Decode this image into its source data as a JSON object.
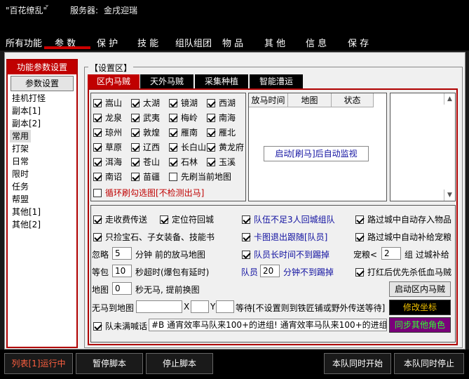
{
  "titlebar": {
    "app_name": "\"百花缭乱\"",
    "chevron": "ˇ",
    "server_label": "服务器:",
    "server_name": "金戌迎瑞"
  },
  "menu": [
    "所有功能",
    "参 数",
    "保 护",
    "技 能",
    "组队组团",
    "物 品",
    "其 他",
    "信 息",
    "保 存"
  ],
  "sidebar": {
    "title": "功能参数设置",
    "button": "参数设置",
    "items": [
      "挂机打怪",
      "副本[1]",
      "副本[2]",
      "常用",
      "打架",
      "日常",
      "限时",
      "任务",
      "帮盟",
      "其他[1]",
      "其他[2]"
    ]
  },
  "settings": {
    "group_label": "【设置区】",
    "tabs": [
      "区内马贼",
      "天外马贼",
      "采集种植",
      "智能漕运"
    ]
  },
  "regions": {
    "items": [
      "嵩山",
      "太湖",
      "镜湖",
      "西湖",
      "龙泉",
      "武夷",
      "梅岭",
      "南海",
      "琼州",
      "敦煌",
      "雁南",
      "雁北",
      "草原",
      "辽西",
      "长白山",
      "黄龙府",
      "洱海",
      "苍山",
      "石林",
      "玉溪",
      "南诏",
      "苗疆"
    ],
    "first_refresh": "先刷当前地图",
    "loop_refresh": "循环刷勾选图[不检测出马]"
  },
  "table": {
    "headers": [
      "放马时间",
      "地图",
      "状态"
    ],
    "monitor_button": "启动[刷马]后自动监视"
  },
  "options": {
    "row1": [
      "走收费传送",
      "定位符回城",
      "队伍不足3人回城组队",
      "路过城中自动存入物品"
    ],
    "row2": [
      "只捡宝石、子女装备、技能书",
      "卡图退出跟随[队员]",
      "路过城中自动补给宠粮"
    ],
    "ignore_pre": "忽略",
    "ignore_val": "5",
    "ignore_post": "分钟 前的放马地图",
    "member_long": "队员长时间不到踢掉",
    "pet_food_pre": "宠粮<",
    "pet_food_val": "2",
    "pet_food_post": "组 过城补给",
    "wait_pre": "等包",
    "wait_val": "10",
    "wait_post": "秒超时(爆包有延时)",
    "member_pre": "队员",
    "member_val": "20",
    "member_post": "分钟不到踢掉",
    "red_first": "打红后优先杀低血马贼",
    "map_pre": "地图",
    "map_val": "0",
    "map_post": "秒无马, 提前换图",
    "start_button": "启动区内马贼",
    "no_horse_label": "无马到地图",
    "x_label": "X",
    "y_label": "Y",
    "wait_note": "等待[不设置则到铁匠铺或野外传送等待]",
    "edit_coord": "修改坐标",
    "team_shout": "队未满喊话",
    "shout_text": "#B 通宵效率马队来100+的进组! 通宵效率马队来100+的进组!",
    "sync_role": "同步其他角色"
  },
  "bottom": [
    "列表[1]运行中",
    "暂停脚本",
    "停止脚本",
    "本队同时开始",
    "本队同时停止"
  ]
}
